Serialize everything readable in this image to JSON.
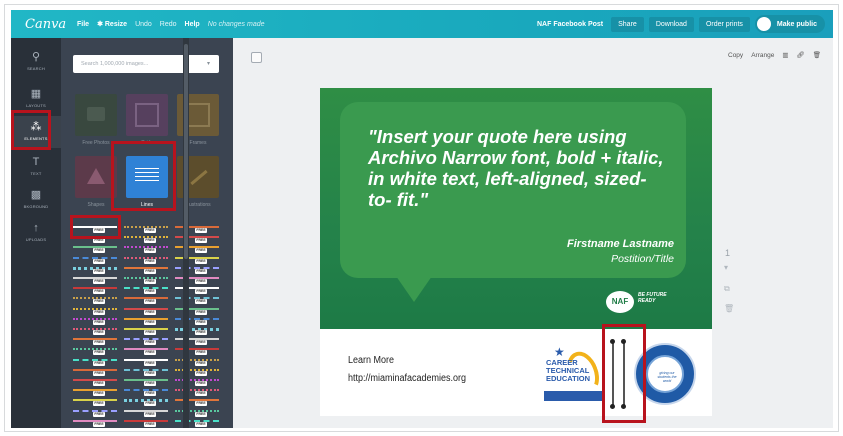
{
  "topbar": {
    "logo": "Canva",
    "menu": [
      "File",
      "✱ Resize",
      "Undo",
      "Redo",
      "Help"
    ],
    "status": "No changes made",
    "doc_title": "NAF Facebook Post",
    "buttons": [
      "Share",
      "Download",
      "Order prints"
    ],
    "make_public": "Make public"
  },
  "rail": [
    {
      "icon": "search-icon",
      "glyph": "⚲",
      "label": "SEARCH"
    },
    {
      "icon": "layouts-icon",
      "glyph": "▦",
      "label": "LAYOUTS"
    },
    {
      "icon": "elements-icon",
      "glyph": "⁂",
      "label": "ELEMENTS"
    },
    {
      "icon": "text-icon",
      "glyph": "T",
      "label": "TEXT"
    },
    {
      "icon": "background-icon",
      "glyph": "▩",
      "label": "BKGROUND"
    },
    {
      "icon": "uploads-icon",
      "glyph": "↑",
      "label": "UPLOADS"
    }
  ],
  "panel": {
    "search_placeholder": "Search 1,000,000 images...",
    "tiles": [
      {
        "label": "Free Photos",
        "color": "#39483f"
      },
      {
        "label": "Grids",
        "color": "#56405e"
      },
      {
        "label": "Frames",
        "color": "#6b5a37"
      },
      {
        "label": "Shapes",
        "color": "#5c3a4a"
      },
      {
        "label": "Lines",
        "color": "#2f82d6"
      },
      {
        "label": "Illustrations",
        "color": "#5c4d2c"
      }
    ],
    "free_badge": "FREE"
  },
  "toolbar": {
    "copy": "Copy",
    "arrange": "Arrange"
  },
  "design": {
    "quote": "\"Insert your quote here using Archivo Narrow font, bold + italic, in white text, left-aligned, sized-to- fit.\"",
    "name": "Firstname Lastname",
    "title": "Postition/Title",
    "naf": "NAF",
    "naf_tag": "BE FUTURE READY",
    "learn_more": "Learn More",
    "url": "http://miaminafacademies.org",
    "cte_text": "CAREER TECHNICAL EDUCATION",
    "seal_text": "giving our students the world"
  },
  "page_controls": {
    "page_number": "1"
  },
  "colors": {
    "topbar": "#1fb1c3",
    "rail": "#293039",
    "panel": "#3b4451",
    "highlight": "#b8131d",
    "design_green": "#2f8e45"
  }
}
